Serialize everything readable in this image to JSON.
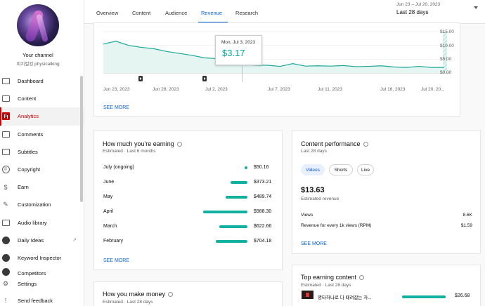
{
  "channel": {
    "title": "Your channel",
    "handle": "피지컬킹 physicalking"
  },
  "sidebar": {
    "items": [
      {
        "label": "Dashboard"
      },
      {
        "label": "Content"
      },
      {
        "label": "Analytics"
      },
      {
        "label": "Comments"
      },
      {
        "label": "Subtitles"
      },
      {
        "label": "Copyright"
      },
      {
        "label": "Earn"
      },
      {
        "label": "Customization"
      },
      {
        "label": "Audio library"
      },
      {
        "label": "Daily Ideas"
      },
      {
        "label": "Keyword Inspector"
      },
      {
        "label": "Competitors"
      }
    ],
    "bottom": [
      {
        "label": "Settings"
      },
      {
        "label": "Send feedback"
      }
    ]
  },
  "tabs": [
    {
      "label": "Overview"
    },
    {
      "label": "Content"
    },
    {
      "label": "Audience"
    },
    {
      "label": "Revenue"
    },
    {
      "label": "Research"
    }
  ],
  "date_range": {
    "small": "Jun 23 – Jul 20, 2023",
    "label": "Last 28 days"
  },
  "revenue_chart": {
    "y_ticks": [
      "$15.00",
      "$10.00",
      "$5.00",
      "$0.00"
    ],
    "x_ticks": [
      "Jun 23, 2023",
      "Jun 28, 2023",
      "Jul 2, 2023",
      "Jul 7, 2023",
      "Jul 11, 2023",
      "Jul 16, 2023",
      "Jul 20, 20..."
    ],
    "tooltip_date": "Mon, Jul 3, 2023",
    "tooltip_value": "$3.17",
    "see_more": "SEE MORE"
  },
  "chart_data": {
    "type": "area",
    "ylim": [
      0,
      15
    ],
    "x": [
      "Jun 23",
      "Jun 24",
      "Jun 25",
      "Jun 26",
      "Jun 27",
      "Jun 28",
      "Jun 29",
      "Jun 30",
      "Jul 1",
      "Jul 2",
      "Jul 3",
      "Jul 4",
      "Jul 5",
      "Jul 6",
      "Jul 7",
      "Jul 8",
      "Jul 9",
      "Jul 10",
      "Jul 11",
      "Jul 12",
      "Jul 13",
      "Jul 14",
      "Jul 15",
      "Jul 16",
      "Jul 17",
      "Jul 18",
      "Jul 19",
      "Jul 20"
    ],
    "series": [
      {
        "values": [
          10.5,
          11.5,
          10.0,
          9.3,
          8.8,
          7.8,
          7.1,
          6.4,
          5.5,
          5.2,
          4.2,
          3.17,
          2.9,
          2.8,
          2.4,
          3.4,
          2.5,
          2.6,
          2.5,
          2.7,
          2.3,
          2.4,
          2.6,
          2.2,
          2.0,
          2.4,
          2.0,
          2.0
        ]
      }
    ],
    "partial_period_start": "Jul 20"
  },
  "earning": {
    "title": "How much you're earning",
    "sub": "Estimated · Last 6 months",
    "rows": [
      {
        "month": "July (ongoing)",
        "value": "$50.16",
        "amount": 50.16
      },
      {
        "month": "June",
        "value": "$373.21",
        "amount": 373.21
      },
      {
        "month": "May",
        "value": "$489.74",
        "amount": 489.74
      },
      {
        "month": "April",
        "value": "$988.30",
        "amount": 988.3
      },
      {
        "month": "March",
        "value": "$622.66",
        "amount": 622.66
      },
      {
        "month": "February",
        "value": "$704.18",
        "amount": 704.18
      }
    ],
    "see_more": "SEE MORE"
  },
  "performance": {
    "title": "Content performance",
    "sub": "Last 28 days",
    "chips": [
      "Videos",
      "Shorts",
      "Live"
    ],
    "revenue_value": "$13.63",
    "revenue_label": "Estimated revenue",
    "views_label": "Views",
    "views_value": "8.6K",
    "rpm_label": "Revenue for every 1k views (RPM)",
    "rpm_value": "$1.59",
    "see_more": "SEE MORE"
  },
  "make_money": {
    "title": "How you make money",
    "sub": "Estimated · Last 28 days"
  },
  "top_earning": {
    "title": "Top earning content",
    "sub": "Estimated · Last 28 days",
    "item_title": "명타하나로 다 때려잡는 자...",
    "item_value": "$26.68"
  },
  "colors": {
    "accent": "#065fd4",
    "active_red": "#cc0000",
    "teal": "#12b0a0"
  }
}
